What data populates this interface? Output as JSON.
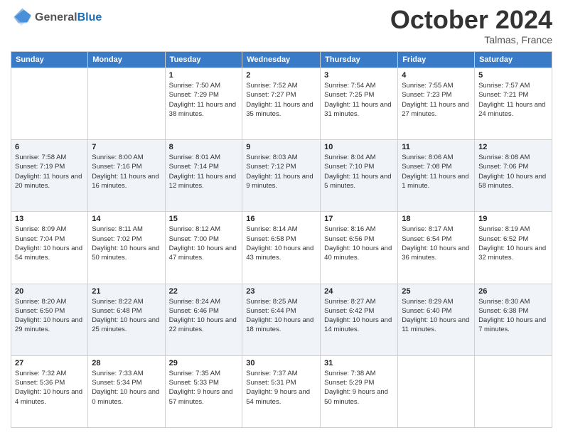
{
  "header": {
    "logo_general": "General",
    "logo_blue": "Blue",
    "month_title": "October 2024",
    "location": "Talmas, France"
  },
  "weekdays": [
    "Sunday",
    "Monday",
    "Tuesday",
    "Wednesday",
    "Thursday",
    "Friday",
    "Saturday"
  ],
  "weeks": [
    [
      {
        "day": "",
        "info": ""
      },
      {
        "day": "",
        "info": ""
      },
      {
        "day": "1",
        "info": "Sunrise: 7:50 AM\nSunset: 7:29 PM\nDaylight: 11 hours and 38 minutes."
      },
      {
        "day": "2",
        "info": "Sunrise: 7:52 AM\nSunset: 7:27 PM\nDaylight: 11 hours and 35 minutes."
      },
      {
        "day": "3",
        "info": "Sunrise: 7:54 AM\nSunset: 7:25 PM\nDaylight: 11 hours and 31 minutes."
      },
      {
        "day": "4",
        "info": "Sunrise: 7:55 AM\nSunset: 7:23 PM\nDaylight: 11 hours and 27 minutes."
      },
      {
        "day": "5",
        "info": "Sunrise: 7:57 AM\nSunset: 7:21 PM\nDaylight: 11 hours and 24 minutes."
      }
    ],
    [
      {
        "day": "6",
        "info": "Sunrise: 7:58 AM\nSunset: 7:19 PM\nDaylight: 11 hours and 20 minutes."
      },
      {
        "day": "7",
        "info": "Sunrise: 8:00 AM\nSunset: 7:16 PM\nDaylight: 11 hours and 16 minutes."
      },
      {
        "day": "8",
        "info": "Sunrise: 8:01 AM\nSunset: 7:14 PM\nDaylight: 11 hours and 12 minutes."
      },
      {
        "day": "9",
        "info": "Sunrise: 8:03 AM\nSunset: 7:12 PM\nDaylight: 11 hours and 9 minutes."
      },
      {
        "day": "10",
        "info": "Sunrise: 8:04 AM\nSunset: 7:10 PM\nDaylight: 11 hours and 5 minutes."
      },
      {
        "day": "11",
        "info": "Sunrise: 8:06 AM\nSunset: 7:08 PM\nDaylight: 11 hours and 1 minute."
      },
      {
        "day": "12",
        "info": "Sunrise: 8:08 AM\nSunset: 7:06 PM\nDaylight: 10 hours and 58 minutes."
      }
    ],
    [
      {
        "day": "13",
        "info": "Sunrise: 8:09 AM\nSunset: 7:04 PM\nDaylight: 10 hours and 54 minutes."
      },
      {
        "day": "14",
        "info": "Sunrise: 8:11 AM\nSunset: 7:02 PM\nDaylight: 10 hours and 50 minutes."
      },
      {
        "day": "15",
        "info": "Sunrise: 8:12 AM\nSunset: 7:00 PM\nDaylight: 10 hours and 47 minutes."
      },
      {
        "day": "16",
        "info": "Sunrise: 8:14 AM\nSunset: 6:58 PM\nDaylight: 10 hours and 43 minutes."
      },
      {
        "day": "17",
        "info": "Sunrise: 8:16 AM\nSunset: 6:56 PM\nDaylight: 10 hours and 40 minutes."
      },
      {
        "day": "18",
        "info": "Sunrise: 8:17 AM\nSunset: 6:54 PM\nDaylight: 10 hours and 36 minutes."
      },
      {
        "day": "19",
        "info": "Sunrise: 8:19 AM\nSunset: 6:52 PM\nDaylight: 10 hours and 32 minutes."
      }
    ],
    [
      {
        "day": "20",
        "info": "Sunrise: 8:20 AM\nSunset: 6:50 PM\nDaylight: 10 hours and 29 minutes."
      },
      {
        "day": "21",
        "info": "Sunrise: 8:22 AM\nSunset: 6:48 PM\nDaylight: 10 hours and 25 minutes."
      },
      {
        "day": "22",
        "info": "Sunrise: 8:24 AM\nSunset: 6:46 PM\nDaylight: 10 hours and 22 minutes."
      },
      {
        "day": "23",
        "info": "Sunrise: 8:25 AM\nSunset: 6:44 PM\nDaylight: 10 hours and 18 minutes."
      },
      {
        "day": "24",
        "info": "Sunrise: 8:27 AM\nSunset: 6:42 PM\nDaylight: 10 hours and 14 minutes."
      },
      {
        "day": "25",
        "info": "Sunrise: 8:29 AM\nSunset: 6:40 PM\nDaylight: 10 hours and 11 minutes."
      },
      {
        "day": "26",
        "info": "Sunrise: 8:30 AM\nSunset: 6:38 PM\nDaylight: 10 hours and 7 minutes."
      }
    ],
    [
      {
        "day": "27",
        "info": "Sunrise: 7:32 AM\nSunset: 5:36 PM\nDaylight: 10 hours and 4 minutes."
      },
      {
        "day": "28",
        "info": "Sunrise: 7:33 AM\nSunset: 5:34 PM\nDaylight: 10 hours and 0 minutes."
      },
      {
        "day": "29",
        "info": "Sunrise: 7:35 AM\nSunset: 5:33 PM\nDaylight: 9 hours and 57 minutes."
      },
      {
        "day": "30",
        "info": "Sunrise: 7:37 AM\nSunset: 5:31 PM\nDaylight: 9 hours and 54 minutes."
      },
      {
        "day": "31",
        "info": "Sunrise: 7:38 AM\nSunset: 5:29 PM\nDaylight: 9 hours and 50 minutes."
      },
      {
        "day": "",
        "info": ""
      },
      {
        "day": "",
        "info": ""
      }
    ]
  ]
}
